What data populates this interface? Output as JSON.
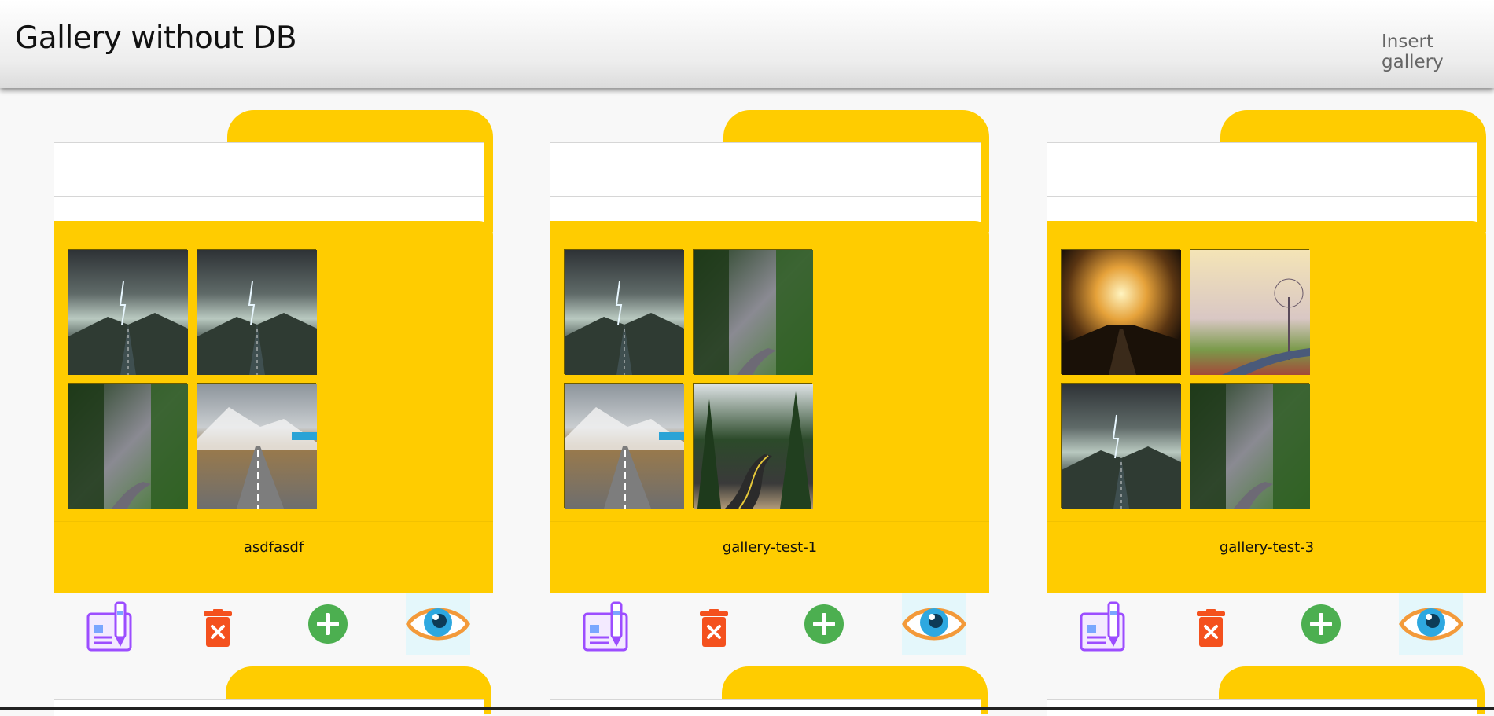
{
  "navbar": {
    "brand": "Gallery without DB",
    "insert_link": "Insert gallery"
  },
  "galleries": [
    {
      "name": "asdfasdf",
      "thumbs": [
        "storm-road",
        "storm-road",
        "forest-path",
        "mountain-road"
      ]
    },
    {
      "name": "gallery-test-1",
      "thumbs": [
        "storm-road",
        "forest-path",
        "mountain-road",
        "pine-road"
      ]
    },
    {
      "name": "gallery-test-3",
      "thumbs": [
        "sunset-road",
        "misty-tree",
        "storm-road",
        "forest-path"
      ]
    }
  ],
  "actions": [
    "edit-icon",
    "delete-icon",
    "add-icon",
    "view-icon"
  ],
  "colors": {
    "folder": "#ffcc00",
    "delete": "#f4511e",
    "add": "#4caf50",
    "edit": "#9c4dff",
    "eye_iris": "#2ea8e0",
    "eye_outline": "#f39a3a"
  }
}
